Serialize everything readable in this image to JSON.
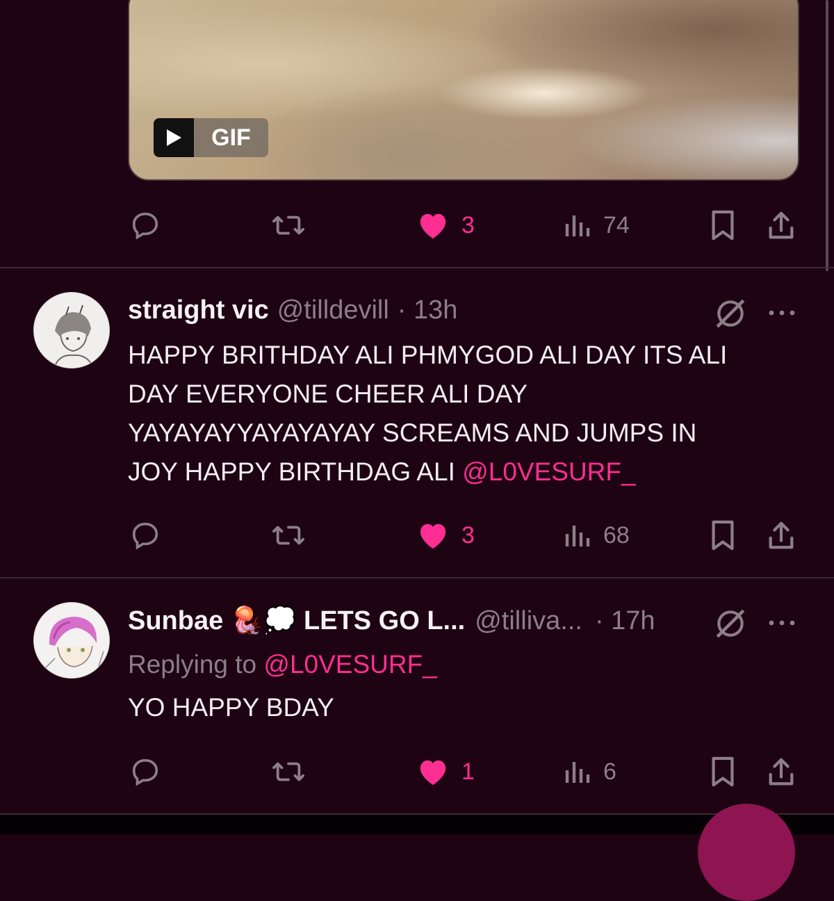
{
  "gif": {
    "label": "GIF"
  },
  "tweets": [
    {
      "actions": {
        "likes": "3",
        "views": "74"
      }
    },
    {
      "display_name": "straight vic",
      "handle": "@tilldevill",
      "time": "· 13h",
      "text_lines": [
        "HAPPY BRITHDAY ALI PHMYGOD ALI DAY ITS ALI",
        "DAY EVERYONE CHEER ALI DAY",
        "YAYAYAYYAYAYAYAY SCREAMS AND JUMPS IN",
        "JOY HAPPY BIRTHDAG ALI "
      ],
      "mention": "@L0VESURF_",
      "actions": {
        "likes": "3",
        "views": "68"
      }
    },
    {
      "display_name": "Sunbae 🪼💭 LETS GO L...",
      "handle": "@tilliva...",
      "time": "· 17h",
      "replying_prefix": "Replying to ",
      "replying_to": "@L0VESURF_",
      "text": "YO HAPPY BDAY",
      "actions": {
        "likes": "1",
        "views": "6"
      }
    }
  ],
  "colors": {
    "background": "#1e0312",
    "accent": "#ff2e92",
    "muted": "#8c7f86"
  },
  "icons": [
    "reply-icon",
    "repost-icon",
    "like-icon",
    "views-icon",
    "bookmark-icon",
    "share-icon",
    "grok-icon",
    "more-icon",
    "play-icon"
  ]
}
